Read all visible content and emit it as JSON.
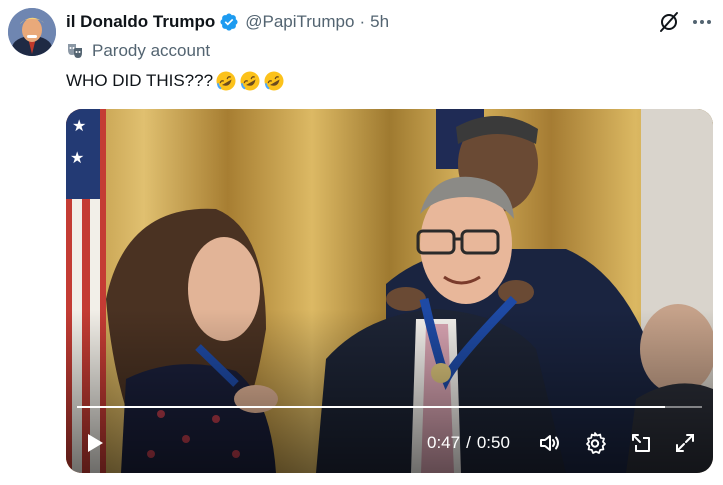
{
  "author": {
    "display_name": "il Donaldo Trumpo",
    "handle": "@PapiTrumpo",
    "separator": "·",
    "time": "5h",
    "verified": true,
    "parody_label": "Parody account"
  },
  "post": {
    "text": "WHO DID THIS???",
    "emojis": [
      "rolling-on-floor-laughing",
      "rolling-on-floor-laughing",
      "rolling-on-floor-laughing"
    ]
  },
  "video": {
    "current_time": "0:47",
    "time_separator": "/",
    "duration": "0:50",
    "progress_fraction": 0.94,
    "state": "paused"
  },
  "colors": {
    "verified_blue": "#1d9bf0",
    "secondary_text": "#536471",
    "primary_text": "#0f1419"
  },
  "icons": {
    "verified": "verified-badge-icon",
    "grok": "grok-icon",
    "more": "more-icon",
    "parody": "theater-masks-icon",
    "play": "play-icon",
    "volume": "volume-icon",
    "settings": "gear-icon",
    "pip": "picture-in-picture-icon",
    "fullscreen": "fullscreen-icon"
  }
}
